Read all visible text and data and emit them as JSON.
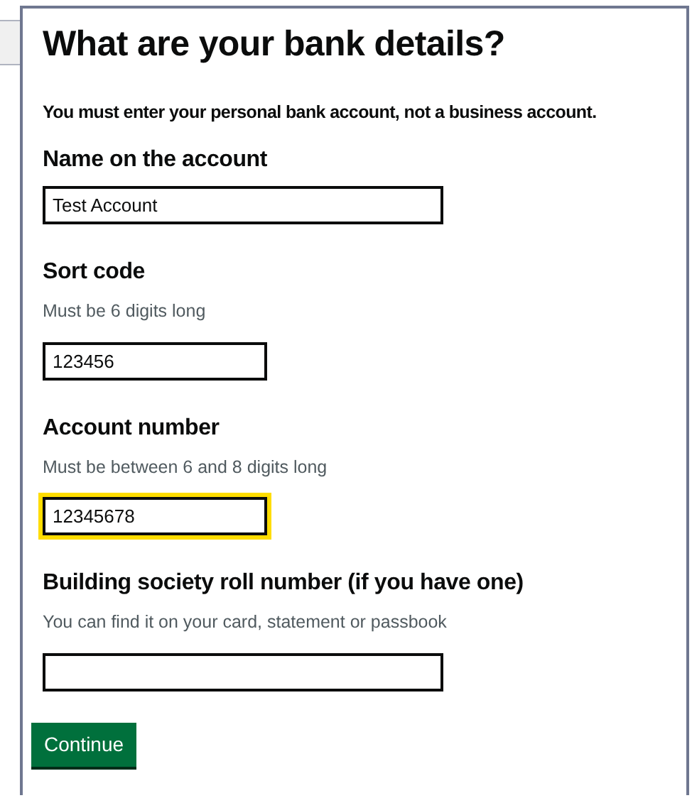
{
  "title": "What are your bank details?",
  "intro": "You must enter your personal bank account, not a business account.",
  "fields": [
    {
      "label": "Name on the account",
      "value": "Test Account",
      "focused": false,
      "kind": "wide"
    },
    {
      "label": "Sort code",
      "hint": "Must be 6 digits long",
      "value": "123456",
      "focused": false,
      "kind": "short"
    },
    {
      "label": "Account number",
      "hint": "Must be between 6 and 8 digits long",
      "value": "12345678",
      "focused": true,
      "kind": "short"
    },
    {
      "label": "Building society roll number (if you have one)",
      "hint": "You can find it on your card, statement or passbook",
      "focused": false,
      "kind": "wide"
    }
  ],
  "button": "Continue"
}
